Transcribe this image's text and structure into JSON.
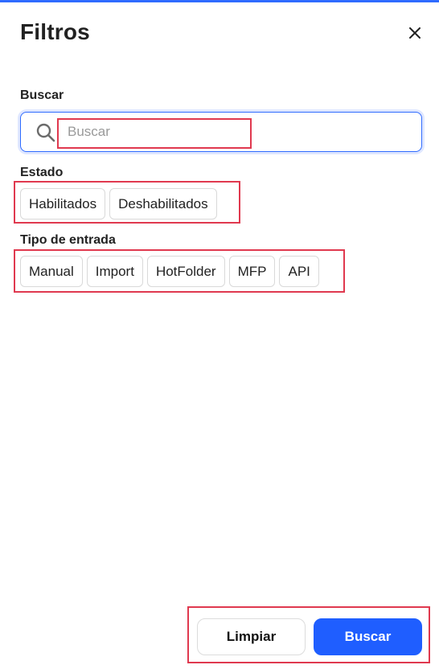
{
  "header": {
    "title": "Filtros",
    "close_icon": "close-icon"
  },
  "search": {
    "label": "Buscar",
    "placeholder": "Buscar",
    "value": "",
    "icon": "search-icon"
  },
  "estado": {
    "label": "Estado",
    "options": [
      "Habilitados",
      "Deshabilitados"
    ]
  },
  "tipo_entrada": {
    "label": "Tipo de entrada",
    "options": [
      "Manual",
      "Import",
      "HotFolder",
      "MFP",
      "API"
    ]
  },
  "actions": {
    "clear_label": "Limpiar",
    "search_label": "Buscar"
  },
  "colors": {
    "accent": "#1f5eff",
    "highlight": "#e0394f",
    "top_strip": "#2f6bff"
  }
}
